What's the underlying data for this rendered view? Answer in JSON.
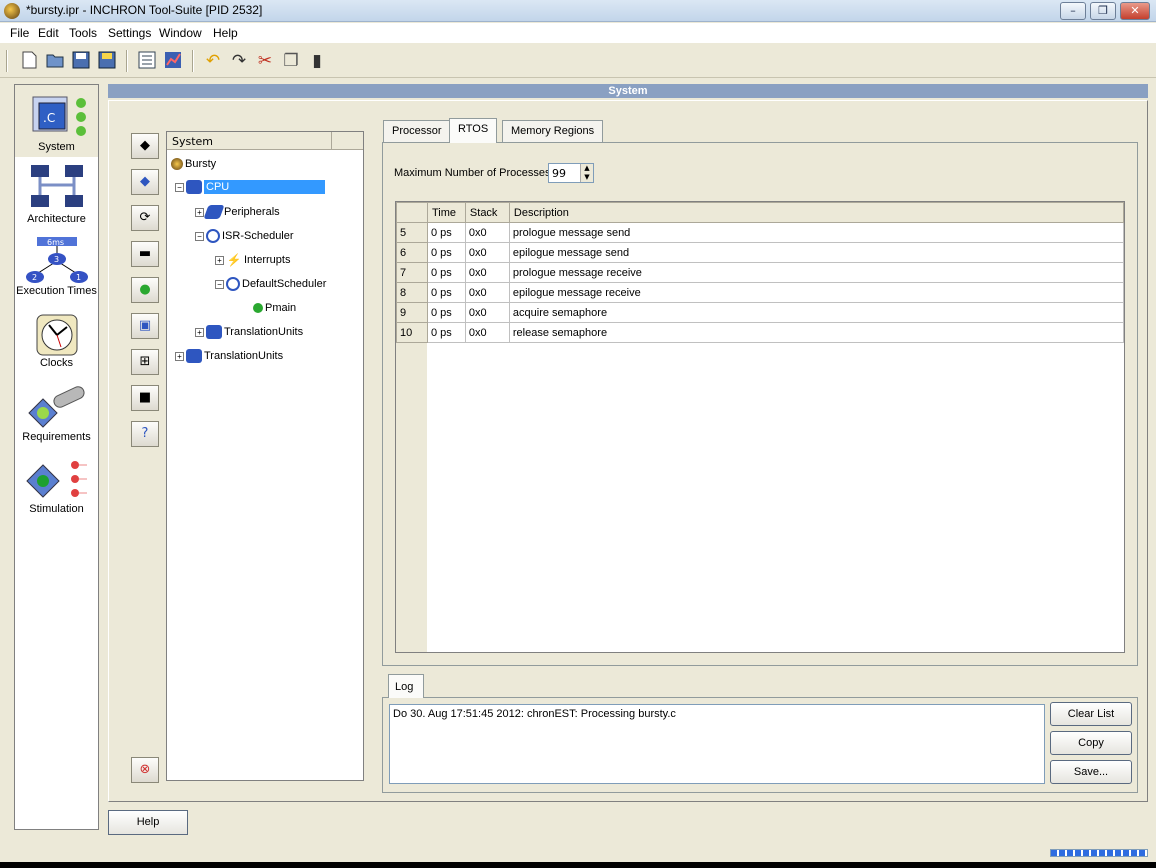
{
  "window": {
    "title": "*bursty.ipr - INCHRON Tool-Suite [PID 2532]",
    "controls": [
      "–",
      "❐",
      "✕"
    ]
  },
  "menu": [
    "File",
    "Edit",
    "Tools",
    "Settings",
    "Window",
    "Help"
  ],
  "toolbar": {
    "icons": [
      "new-icon",
      "open-icon",
      "save-icon",
      "save-all-icon",
      "properties-icon",
      "chart-icon",
      "undo-icon",
      "redo-icon",
      "cut-icon",
      "copy-icon",
      "paste-icon"
    ]
  },
  "nav": [
    {
      "label": "System"
    },
    {
      "label": "Architecture"
    },
    {
      "label": "Execution Times",
      "badge": "6ms",
      "nodes": [
        "2",
        "3",
        "1"
      ]
    },
    {
      "label": "Clocks"
    },
    {
      "label": "Requirements"
    },
    {
      "label": "Stimulation"
    }
  ],
  "section_title": "System",
  "tree": {
    "header": "System",
    "nodes": [
      "Bursty",
      "CPU",
      "Peripherals",
      "ISR-Scheduler",
      "Interrupts",
      "DefaultScheduler",
      "Pmain",
      "TranslationUnits",
      "TranslationUnits"
    ]
  },
  "tabs": [
    "Processor",
    "RTOS",
    "Memory Regions"
  ],
  "rtos": {
    "max_label": "Maximum Number of Processes",
    "max_value": "99",
    "columns": [
      "Time",
      "Stack",
      "Description"
    ],
    "rows": [
      {
        "id": "5",
        "time": "0 ps",
        "stack": "0x0",
        "desc": "prologue message send"
      },
      {
        "id": "6",
        "time": "0 ps",
        "stack": "0x0",
        "desc": "epilogue message send"
      },
      {
        "id": "7",
        "time": "0 ps",
        "stack": "0x0",
        "desc": "prologue message receive"
      },
      {
        "id": "8",
        "time": "0 ps",
        "stack": "0x0",
        "desc": "epilogue message receive"
      },
      {
        "id": "9",
        "time": "0 ps",
        "stack": "0x0",
        "desc": "acquire semaphore"
      },
      {
        "id": "10",
        "time": "0 ps",
        "stack": "0x0",
        "desc": "release semaphore"
      }
    ]
  },
  "log": {
    "tab": "Log",
    "text": "Do 30. Aug 17:51:45 2012: chronEST: Processing  bursty.c",
    "buttons": [
      "Clear List",
      "Copy",
      "Save..."
    ]
  },
  "help": "Help",
  "colors": {
    "selection": "#3399ff",
    "section_bar": "#8aa0c2"
  }
}
